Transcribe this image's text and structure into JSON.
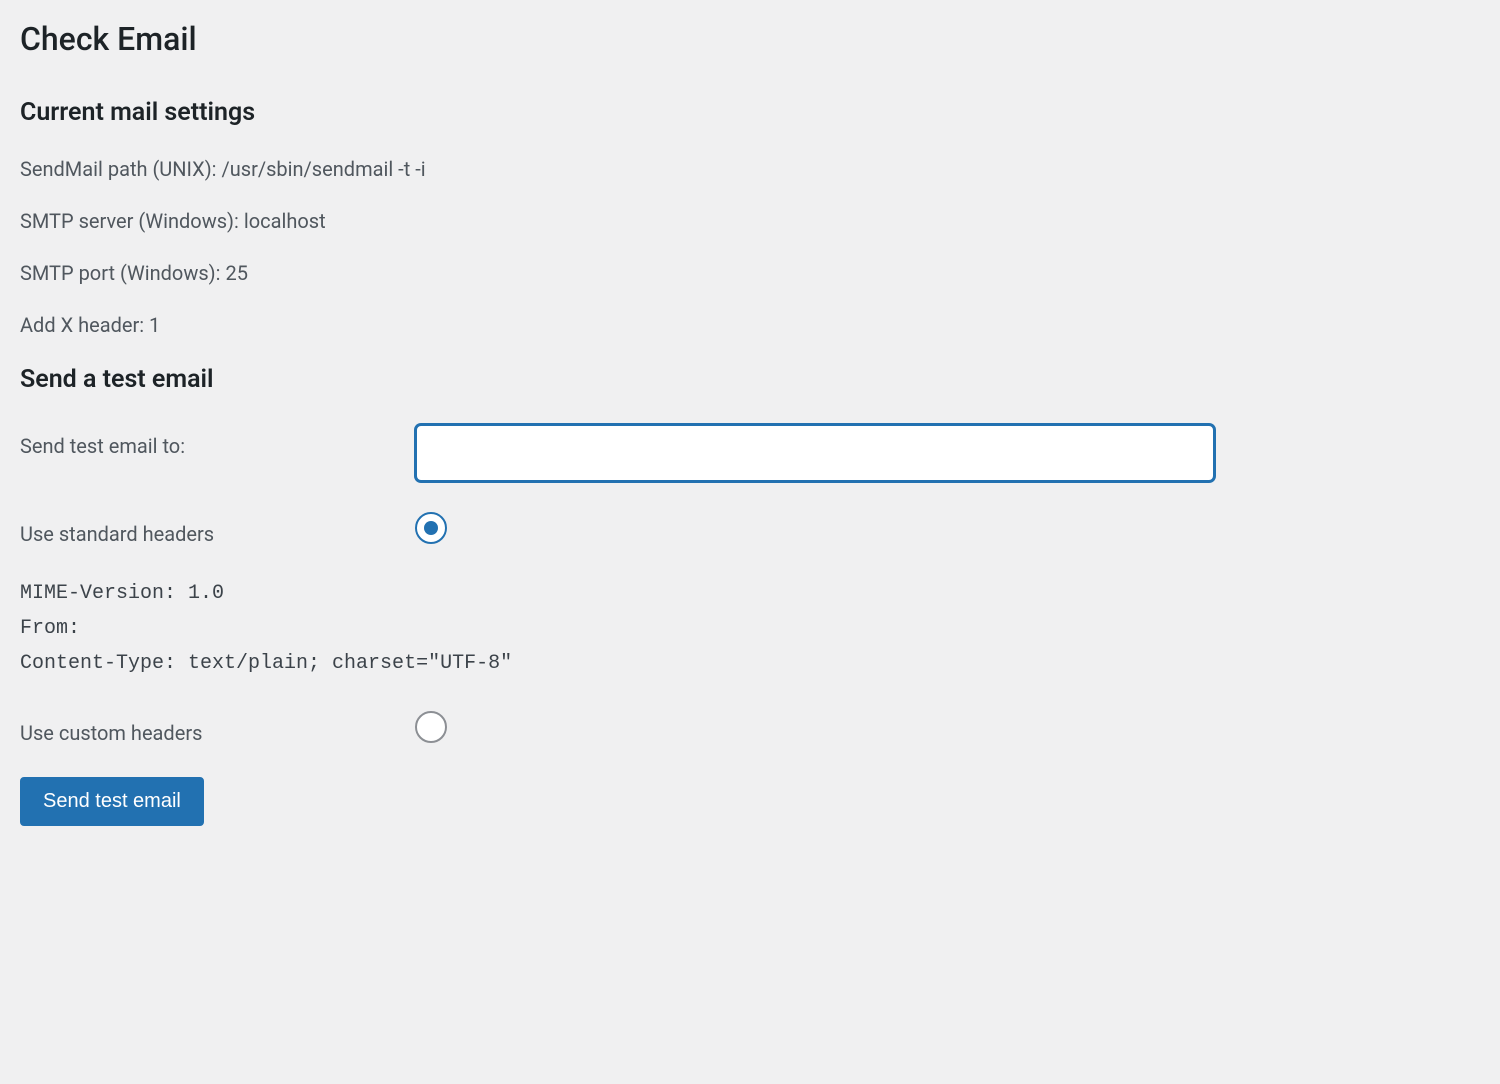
{
  "page": {
    "title": "Check Email"
  },
  "current_settings": {
    "heading": "Current mail settings",
    "sendmail_path_label": "SendMail path (UNIX):",
    "sendmail_path_value": "/usr/sbin/sendmail -t -i",
    "smtp_server_label": "SMTP server (Windows):",
    "smtp_server_value": "localhost",
    "smtp_port_label": "SMTP port (Windows):",
    "smtp_port_value": "25",
    "add_x_header_label": "Add X header:",
    "add_x_header_value": "1"
  },
  "test_email": {
    "heading": "Send a test email",
    "send_to_label": "Send test email to:",
    "send_to_value": "",
    "standard_headers_label": "Use standard headers",
    "standard_headers_checked": true,
    "headers_preview": "MIME-Version: 1.0\nFrom:\nContent-Type: text/plain; charset=\"UTF-8\"",
    "custom_headers_label": "Use custom headers",
    "custom_headers_checked": false,
    "submit_label": "Send test email"
  }
}
